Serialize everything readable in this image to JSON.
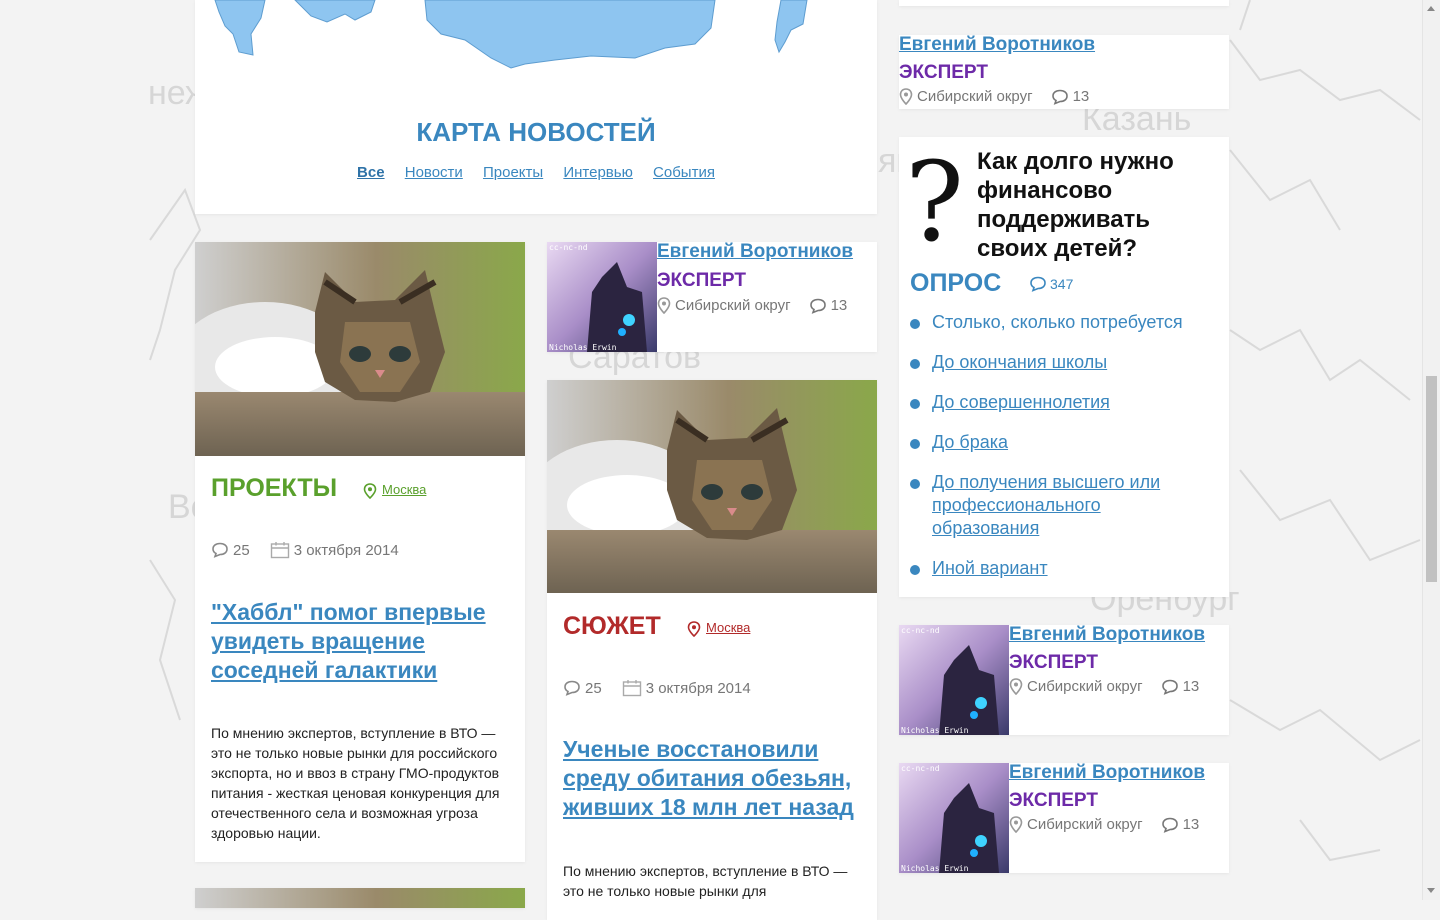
{
  "background_cities": [
    "Казань",
    "Саратов",
    "Оренбург",
    "неж",
    "Во",
    "ян"
  ],
  "news_map": {
    "title": "КАРТА НОВОСТЕЙ",
    "filters": [
      {
        "label": "Все",
        "active": true
      },
      {
        "label": "Новости"
      },
      {
        "label": "Проекты"
      },
      {
        "label": "Интервью"
      },
      {
        "label": "События"
      }
    ]
  },
  "articles": [
    {
      "tag": "ПРОЕКТЫ",
      "tag_color": "#5aa02c",
      "location": "Москва",
      "comments": "25",
      "date": "3 октября 2014",
      "headline": "\"Хаббл\" помог впервые увидеть вращение соседней галактики",
      "excerpt": "По мнению экспертов, вступление в ВТО — это не только новые рынки для российского экспорта, но и ввоз в страну ГМО-продуктов питания - жесткая ценовая конкуренция для отечественного села и возможная угроза здоровью нации."
    },
    {
      "tag": "СЮЖЕТ",
      "tag_color": "#b22a2a",
      "location": "Москва",
      "comments": "25",
      "date": "3 октября 2014",
      "headline": "Ученые восстановили среду обитания обезьян, живших 18 млн лет назад",
      "excerpt": "По мнению экспертов, вступление в ВТО — это не только новые рынки для"
    }
  ],
  "experts": [
    {
      "name": "Евгений Воротников",
      "role": "ЭКСПЕРТ",
      "region": "Сибирский округ",
      "comments": "13"
    },
    {
      "name": "Евгений Воротников",
      "role": "ЭКСПЕРТ",
      "region": "Сибирский округ",
      "comments": "13"
    },
    {
      "name": "Евгений Воротников",
      "role": "ЭКСПЕРТ",
      "region": "Сибирский округ",
      "comments": "13"
    },
    {
      "name": "Евгений Воротников",
      "role": "ЭКСПЕРТ",
      "region": "Сибирский округ",
      "comments": "13"
    }
  ],
  "thumb_caption_top": "cc-nc-nd",
  "thumb_caption_bottom": "Nicholas Erwin",
  "poll": {
    "question": "Как долго нужно финансово поддерживать своих детей?",
    "tag": "ОПРОС",
    "comments": "347",
    "options": [
      "Столько, сколько потребуется",
      "До окончания школы",
      "До совершеннолетия",
      "До брака",
      "До получения высшего или профессионального образования",
      "Иной вариант"
    ]
  },
  "colors": {
    "link": "#3a87bf",
    "expert_role": "#6d2aa8",
    "map_fill": "#8ec5f0"
  }
}
